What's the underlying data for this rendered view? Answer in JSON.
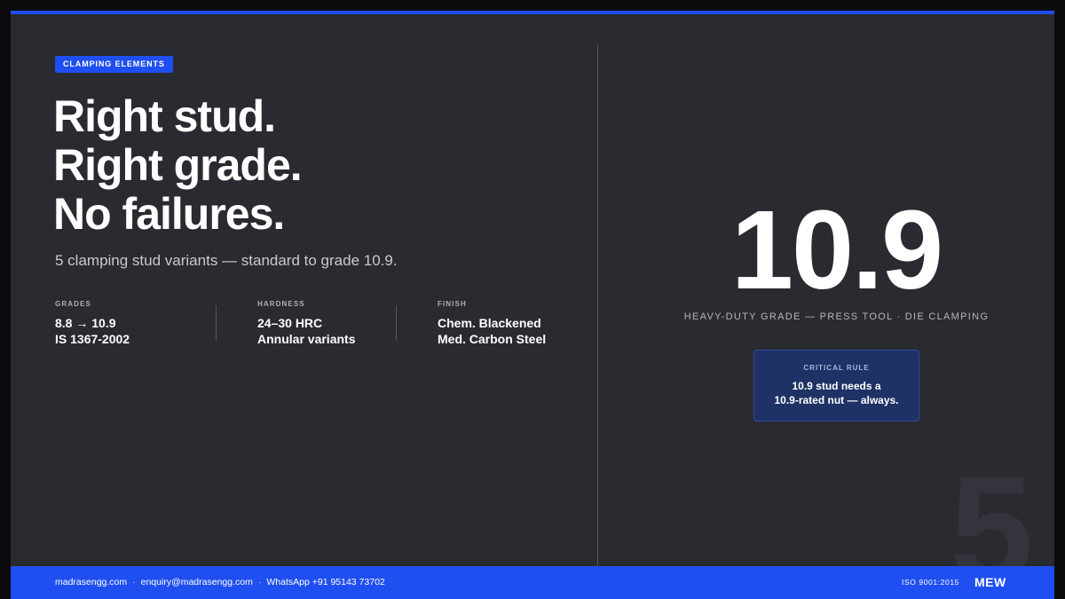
{
  "badge": "CLAMPING ELEMENTS",
  "headline": [
    "Right stud.",
    "Right grade.",
    "No failures."
  ],
  "subtitle": "5 clamping stud variants — standard to grade 10.9.",
  "stats": [
    {
      "label": "GRADES",
      "lines": [
        "8.8 → 10.9",
        "IS 1367-2002"
      ]
    },
    {
      "label": "HARDNESS",
      "lines": [
        "24–30 HRC",
        "Annular variants"
      ]
    },
    {
      "label": "FINISH",
      "lines": [
        "Chem. Blackened",
        "Med. Carbon Steel"
      ]
    }
  ],
  "highlight": {
    "number": "10.9",
    "caption": "HEAVY-DUTY GRADE — PRESS TOOL · DIE CLAMPING"
  },
  "rule_card": {
    "label": "CRITICAL RULE",
    "lines": [
      "10.9 stud needs a",
      "10.9-rated nut — always."
    ]
  },
  "watermark": "5",
  "footer": {
    "website": "madrasengg.com",
    "separator": "·",
    "email": "enquiry@madrasengg.com",
    "whatsapp": "WhatsApp +91 95143 73702",
    "iso": "ISO 9001:2015",
    "brand": "MEW"
  },
  "colors": {
    "accent": "#1f4ff0",
    "background": "#2a2a31",
    "card": "#1e3266"
  }
}
